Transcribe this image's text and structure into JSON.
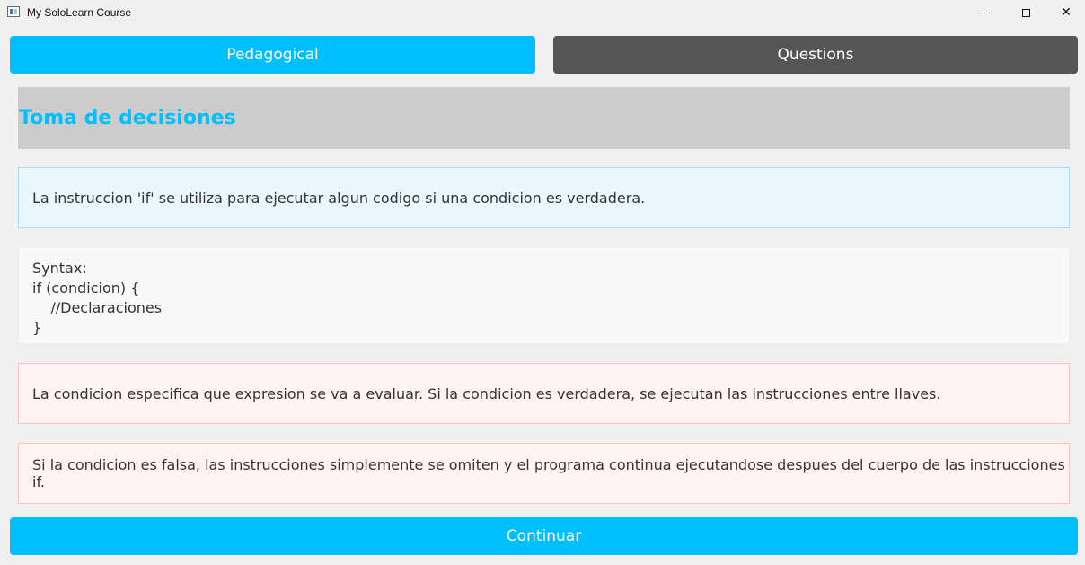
{
  "window": {
    "title": "My SoloLearn Course",
    "icon": "app-window-icon",
    "controls": {
      "minimize": "minimize-icon",
      "maximize": "maximize-icon",
      "close": "✕"
    }
  },
  "tabs": [
    {
      "label": "Pedagogical",
      "active": true,
      "color": "#00bfff"
    },
    {
      "label": "Questions",
      "active": false,
      "color": "#555555"
    }
  ],
  "lesson": {
    "title": "Toma de decisiones",
    "title_color": "#00bfff",
    "intro": "La instruccion 'if' se utiliza para ejecutar algun codigo si una condicion es verdadera.",
    "syntax": {
      "lines": [
        "Syntax:",
        "if (condicion) {",
        "    //Declaraciones",
        "}"
      ]
    },
    "notes": [
      "La condicion especifica que expresion se va a evaluar. Si la condicion es verdadera, se ejecutan las instrucciones entre llaves.",
      "Si la condicion es falsa, las instrucciones simplemente se omiten y el programa continua ejecutandose despues del cuerpo de las instrucciones if."
    ]
  },
  "footer": {
    "continue_label": "Continuar",
    "color": "#00bfff"
  }
}
